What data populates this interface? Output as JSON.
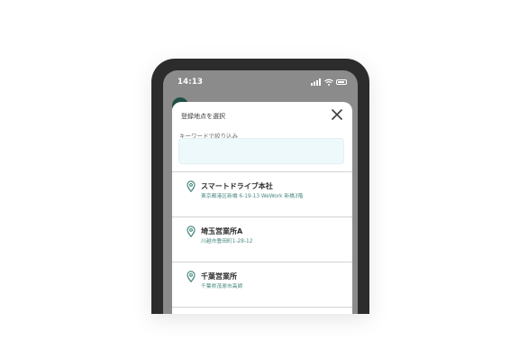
{
  "status_bar": {
    "time": "14:13"
  },
  "sheet": {
    "title": "登録地点を選択",
    "filter_label": "キーワードで絞り込み",
    "search_value": "",
    "search_placeholder": ""
  },
  "locations": [
    {
      "name": "スマートドライブ本社",
      "address": "東京都港区新橋 6-19-13 WeWork 新橋3階"
    },
    {
      "name": "埼玉営業所A",
      "address": "川越市豊田町1-28-12"
    },
    {
      "name": "千葉営業所",
      "address": "千葉県茂原市高師"
    }
  ],
  "colors": {
    "accent": "#4a8a82",
    "input_background": "#eef9fb",
    "phone_frame": "#2c2c2c",
    "overlay": "#8b8b8b"
  },
  "icons": [
    "signal-icon",
    "wifi-icon",
    "battery-icon",
    "close-icon",
    "location-pin-icon"
  ]
}
